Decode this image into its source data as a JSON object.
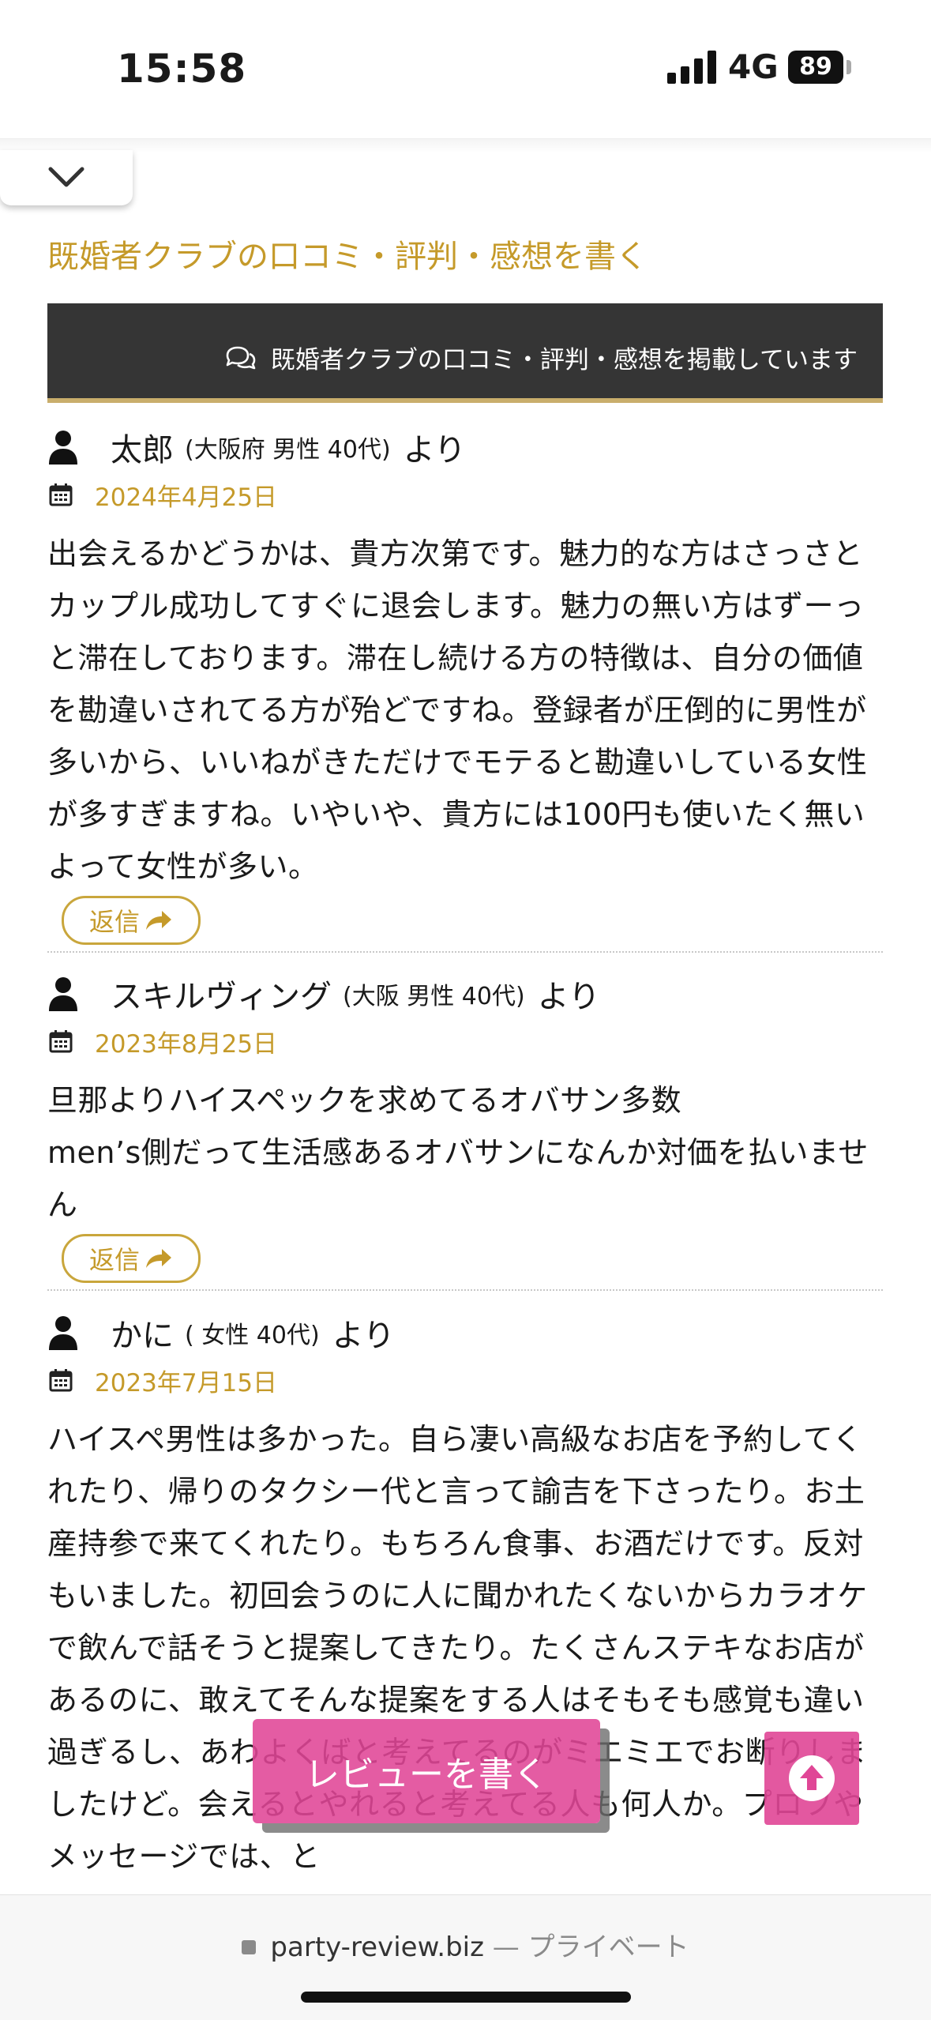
{
  "status": {
    "time": "15:58",
    "network": "4G",
    "battery": "89"
  },
  "section_title": "既婚者クラブの口コミ・評判・感想を書く",
  "banner_text": "既婚者クラブの口コミ・評判・感想を掲載しています",
  "reply_label": "返信",
  "from_label": "より",
  "reviews": [
    {
      "name": "太郎",
      "meta": "(大阪府 男性 40代)",
      "date": "2024年4月25日",
      "body": "出会えるかどうかは、貴方次第です。魅力的な方はさっさとカップル成功してすぐに退会します。魅力の無い方はずーっと滞在しております。滞在し続ける方の特徴は、自分の価値を勘違いされてる方が殆どですね。登録者が圧倒的に男性が多いから、いいねがきただけでモテると勘違いしている女性が多すぎますね。いやいや、貴方には100円も使いたく無いよって女性が多い。"
    },
    {
      "name": "スキルヴィング",
      "meta": "(大阪 男性 40代)",
      "date": "2023年8月25日",
      "body": "旦那よりハイスペックを求めてるオバサン多数\nmen’s側だって生活感あるオバサンになんか対価を払いません"
    },
    {
      "name": "かに",
      "meta": "( 女性 40代)",
      "date": "2023年7月15日",
      "body": "ハイスペ男性は多かった。自ら凄い高級なお店を予約してくれたり、帰りのタクシー代と言って諭吉を下さったり。お土産持参で来てくれたり。もちろん食事、お酒だけです。反対もいました。初回会うのに人に聞かれたくないからカラオケで飲んで話そうと提案してきたり。たくさんステキなお店があるのに、敢えてそんな提案をする人はそもそも感覚も違い過ぎるし、あわよくばと考えてるのがミエミエでお断りしましたけど。会えるとやれると考えてる人も何人か。プロフやメッセージでは、と"
    }
  ],
  "write_review_label": "レビューを書く",
  "browser": {
    "domain": "party-review.biz",
    "separator": "—",
    "mode": "プライベート"
  },
  "colors": {
    "accent": "#c59a2a",
    "banner_bg": "#353535",
    "cta": "#e04696"
  }
}
